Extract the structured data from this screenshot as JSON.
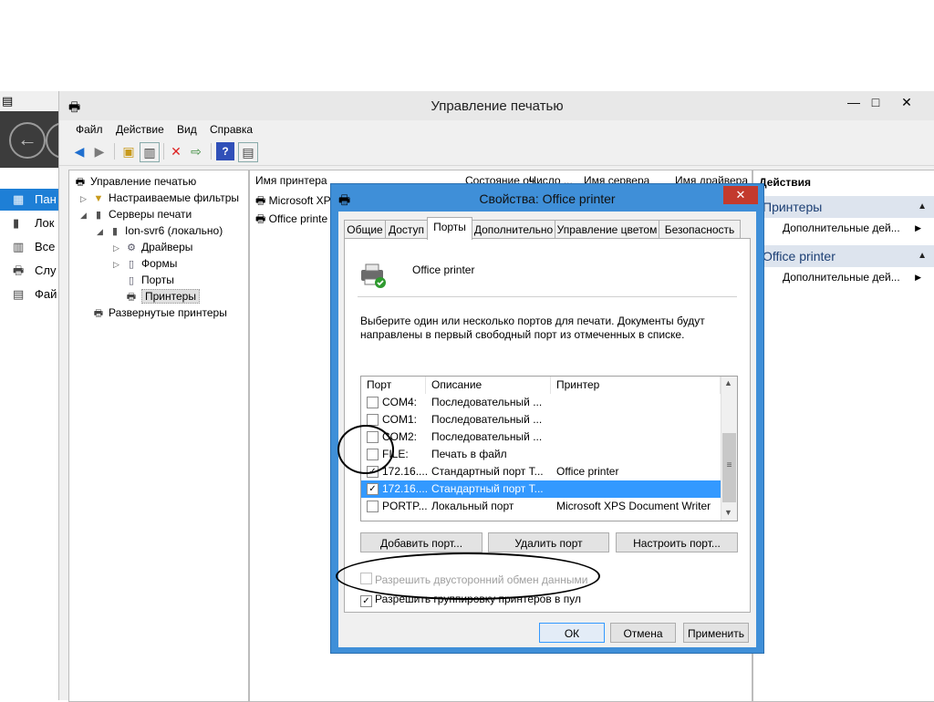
{
  "background_app": {
    "nav_items": [
      {
        "label": "Пан",
        "icon": "dashboard-icon",
        "selected": true
      },
      {
        "label": "Лок",
        "icon": "server-icon",
        "selected": false
      },
      {
        "label": "Все",
        "icon": "servers-icon",
        "selected": false
      },
      {
        "label": "Слу",
        "icon": "printer-icon",
        "selected": false
      },
      {
        "label": "Фай",
        "icon": "files-icon",
        "selected": false
      }
    ]
  },
  "window": {
    "title": "Управление печатью",
    "controls": {
      "minimize": "—",
      "maximize": "□",
      "close": "✕"
    }
  },
  "menu": [
    "Файл",
    "Действие",
    "Вид",
    "Справка"
  ],
  "tree": {
    "items": [
      {
        "label": "Управление печатью",
        "icon": "print-management-icon"
      },
      {
        "label": "Настраиваемые фильтры",
        "icon": "filter-folder-icon"
      },
      {
        "label": "Серверы печати",
        "icon": "server-icon"
      },
      {
        "label": "Ion-svr6 (локально)",
        "icon": "server-icon"
      },
      {
        "label": "Драйверы",
        "icon": "driver-icon"
      },
      {
        "label": "Формы",
        "icon": "forms-icon"
      },
      {
        "label": "Порты",
        "icon": "ports-icon"
      },
      {
        "label": "Принтеры",
        "icon": "printer-icon"
      },
      {
        "label": "Развернутые принтеры",
        "icon": "printer-icon"
      }
    ]
  },
  "list": {
    "headers": [
      "Имя принтера",
      "Состояние оч...",
      "Число ...",
      "Имя сервера",
      "Имя драйвера"
    ],
    "rows": [
      "Microsoft XP",
      "Office printe"
    ]
  },
  "actions": {
    "title": "Действия",
    "sections": [
      {
        "label": "Принтеры",
        "item": "Дополнительные дей..."
      },
      {
        "label": "Office printer",
        "item": "Дополнительные дей..."
      }
    ]
  },
  "dialog": {
    "title": "Свойства: Office printer",
    "close": "✕",
    "tabs": [
      "Общие",
      "Доступ",
      "Порты",
      "Дополнительно",
      "Управление цветом",
      "Безопасность"
    ],
    "active_tab": "Порты",
    "printer_name": "Office printer",
    "description": "Выберите один или несколько портов для печати. Документы будут направлены в первый свободный порт из отмеченных в списке.",
    "port_table": {
      "headers": [
        "Порт",
        "Описание",
        "Принтер"
      ],
      "rows": [
        {
          "port": "COM4:",
          "desc": "Последовательный ...",
          "printer": "",
          "checked": false,
          "selected": false
        },
        {
          "port": "COM1:",
          "desc": "Последовательный ...",
          "printer": "",
          "checked": false,
          "selected": false
        },
        {
          "port": "COM2:",
          "desc": "Последовательный ...",
          "printer": "",
          "checked": false,
          "selected": false
        },
        {
          "port": "FILE:",
          "desc": "Печать в файл",
          "printer": "",
          "checked": false,
          "selected": false
        },
        {
          "port": "172.16....",
          "desc": "Стандартный порт T...",
          "printer": "Office printer",
          "checked": true,
          "selected": false
        },
        {
          "port": "172.16....",
          "desc": "Стандартный порт T...",
          "printer": "",
          "checked": true,
          "selected": true
        },
        {
          "port": "PORTP...",
          "desc": "Локальный порт",
          "printer": "Microsoft XPS Document Writer",
          "checked": false,
          "selected": false
        }
      ]
    },
    "buttons": {
      "add": "Добавить порт...",
      "delete": "Удалить порт",
      "configure": "Настроить порт..."
    },
    "bidirectional": {
      "label": "Разрешить двусторонний обмен данными",
      "checked": false,
      "enabled": false
    },
    "pooling": {
      "label": "Разрешить группировку принтеров в пул",
      "checked": true
    },
    "ok": "ОК",
    "cancel": "Отмена",
    "apply": "Применить"
  },
  "colors": {
    "selection": "#3399ff",
    "dialog_frame": "#3f8fd8",
    "close_red": "#c33a2d",
    "nav_selected": "#1e7fd6"
  }
}
